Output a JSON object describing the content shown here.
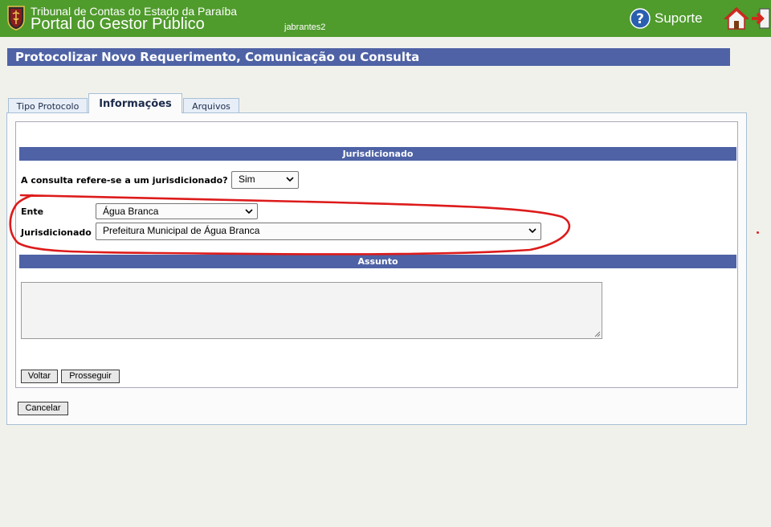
{
  "header": {
    "org_name": "Tribunal de Contas do Estado da Paraíba",
    "portal_name": "Portal do Gestor Público",
    "username": "jabrantes2",
    "support_label": "Suporte",
    "icons": [
      "help-icon",
      "home-icon",
      "exit-icon",
      "logo-emblem"
    ],
    "colors": {
      "header_bg": "#4f9b2c",
      "accent": "#4e62a5"
    }
  },
  "page": {
    "title": "Protocolizar Novo Requerimento, Comunicação ou Consulta"
  },
  "tabs": [
    {
      "label": "Tipo Protocolo",
      "active": false
    },
    {
      "label": "Informações",
      "active": true
    },
    {
      "label": "Arquivos",
      "active": false
    }
  ],
  "jurisdicionado": {
    "section_title": "Jurisdicionado",
    "question": "A consulta refere-se a um jurisdicionado?",
    "question_value": "Sim",
    "ente_label": "Ente",
    "ente_value": "Água Branca",
    "jurisdicionado_label": "Jurisdicionado",
    "jurisdicionado_value": "Prefeitura Municipal de Água Branca"
  },
  "assunto": {
    "section_title": "Assunto",
    "text": ""
  },
  "buttons": {
    "back": "Voltar",
    "next": "Prosseguir",
    "cancel": "Cancelar"
  }
}
